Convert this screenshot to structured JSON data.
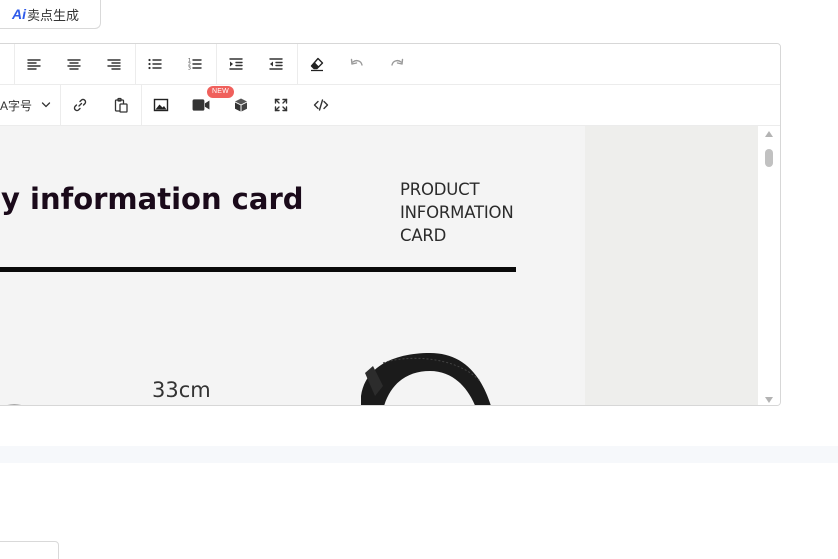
{
  "ai_button": {
    "prefix": "Ai",
    "label": "卖点生成"
  },
  "toolbar": {
    "font_size_label": "A字号",
    "new_badge": "NEW"
  },
  "content": {
    "title": "y information card",
    "subtitle_lines": [
      "PRODUCT",
      "INFORMATION",
      "CARD"
    ],
    "dimension": "33cm"
  },
  "colors": {
    "accent": "#2f5bea",
    "badge": "#f0605c",
    "title": "#1a0a1a"
  }
}
